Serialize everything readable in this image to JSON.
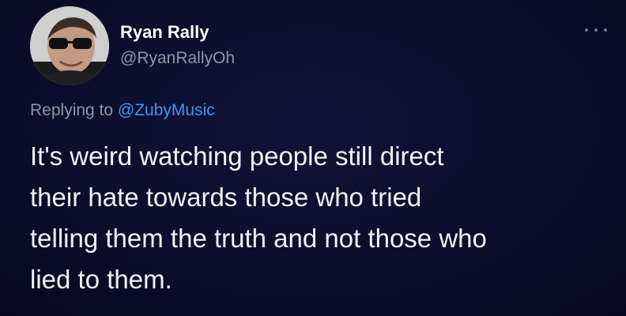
{
  "author": {
    "display_name": "Ryan Rally",
    "handle": "@RyanRallyOh",
    "avatar_icon": "profile-photo-sunglasses"
  },
  "reply": {
    "prefix": "Replying to ",
    "mention": "@ZubyMusic"
  },
  "tweet": {
    "text": "It's weird watching people still direct\ntheir hate towards those who tried\ntelling them the truth and not those who\nlied to them."
  },
  "menu": {
    "icon": "more-options-icon"
  },
  "colors": {
    "background": "#0b0d2a",
    "text": "#f2f4f7",
    "secondary_text": "#8b98a5",
    "link": "#3b99f0"
  }
}
